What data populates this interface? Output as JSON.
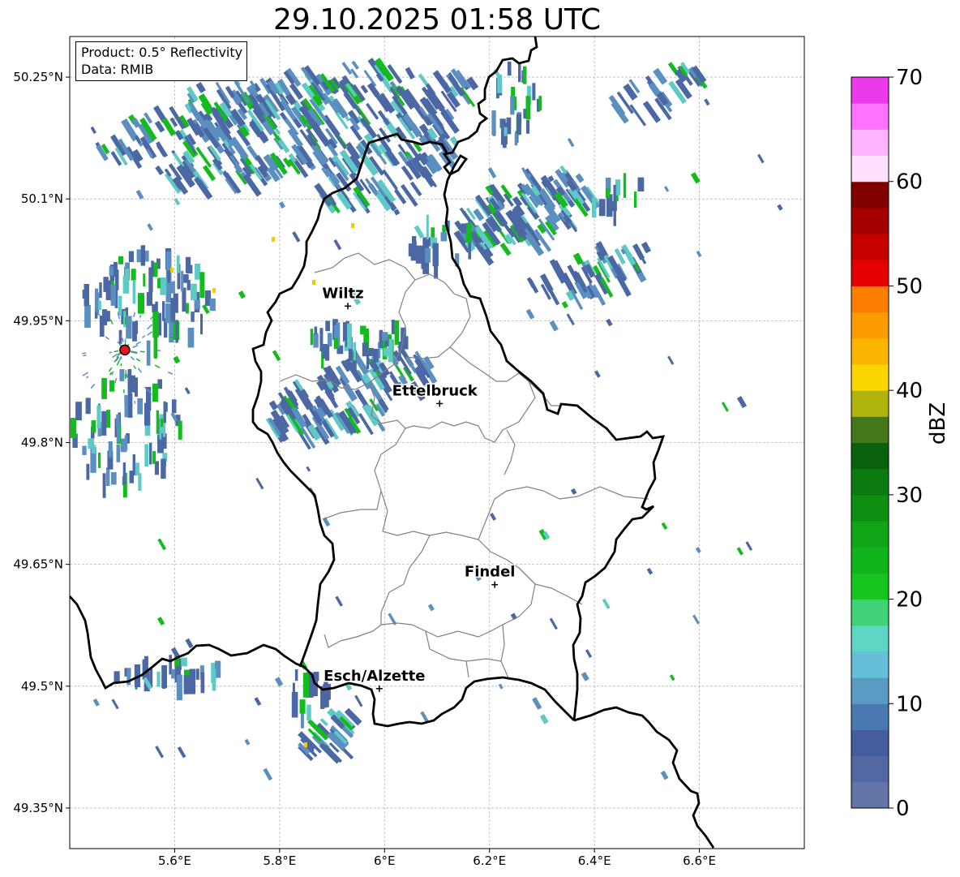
{
  "title": "29.10.2025 01:58 UTC",
  "info": {
    "product": "Product: 0.5° Reflectivity",
    "data": "Data: RMIB"
  },
  "map": {
    "lon_range": [
      5.4,
      6.8
    ],
    "lat_range": [
      49.3,
      50.3
    ],
    "lon_ticks": [
      {
        "value": 5.6,
        "label": "5.6°E"
      },
      {
        "value": 5.8,
        "label": "5.8°E"
      },
      {
        "value": 6.0,
        "label": "6°E"
      },
      {
        "value": 6.2,
        "label": "6.2°E"
      },
      {
        "value": 6.4,
        "label": "6.4°E"
      },
      {
        "value": 6.6,
        "label": "6.6°E"
      }
    ],
    "lat_ticks": [
      {
        "value": 50.25,
        "label": "50.25°N"
      },
      {
        "value": 50.1,
        "label": "50.1°N"
      },
      {
        "value": 49.95,
        "label": "49.95°N"
      },
      {
        "value": 49.8,
        "label": "49.8°N"
      },
      {
        "value": 49.65,
        "label": "49.65°N"
      },
      {
        "value": 49.5,
        "label": "49.5°N"
      },
      {
        "value": 49.35,
        "label": "49.35°N"
      }
    ],
    "cities": [
      {
        "name": "Wiltz",
        "lon": 5.93,
        "lat": 49.968
      },
      {
        "name": "Ettelbruck",
        "lon": 6.105,
        "lat": 49.848
      },
      {
        "name": "Findel",
        "lon": 6.21,
        "lat": 49.625
      },
      {
        "name": "Esch/Alzette",
        "lon": 5.99,
        "lat": 49.497
      }
    ],
    "radar_site": {
      "lon": 5.505,
      "lat": 49.914,
      "color": "#e8141e"
    }
  },
  "colorbar": {
    "label": "dBZ",
    "min": 0,
    "max": 70,
    "ticks": [
      {
        "value": 0,
        "label": "0"
      },
      {
        "value": 10,
        "label": "10"
      },
      {
        "value": 20,
        "label": "20"
      },
      {
        "value": 30,
        "label": "30"
      },
      {
        "value": 40,
        "label": "40"
      },
      {
        "value": 50,
        "label": "50"
      },
      {
        "value": 60,
        "label": "60"
      },
      {
        "value": 70,
        "label": "70"
      }
    ],
    "colors": [
      "#6475a8",
      "#5368a3",
      "#445d9f",
      "#4a78b0",
      "#5a9bc4",
      "#66bfd8",
      "#5fd6c5",
      "#3fd276",
      "#15c41f",
      "#11b41a",
      "#10a416",
      "#0e8f12",
      "#0b7a10",
      "#0a620d",
      "#44761a",
      "#afb30c",
      "#fdd600",
      "#fbb500",
      "#fb9c00",
      "#fc7e00",
      "#e50000",
      "#c50000",
      "#a50000",
      "#800000",
      "#ffe0ff",
      "#ffb4ff",
      "#ff72ff",
      "#ec39ec"
    ]
  },
  "echo_colors": {
    "weak": "#4b68a4",
    "light": "#5b8fc0",
    "moderate": "#5fc9c6",
    "green": "#14bb1c",
    "yellow": "#fbc700"
  }
}
